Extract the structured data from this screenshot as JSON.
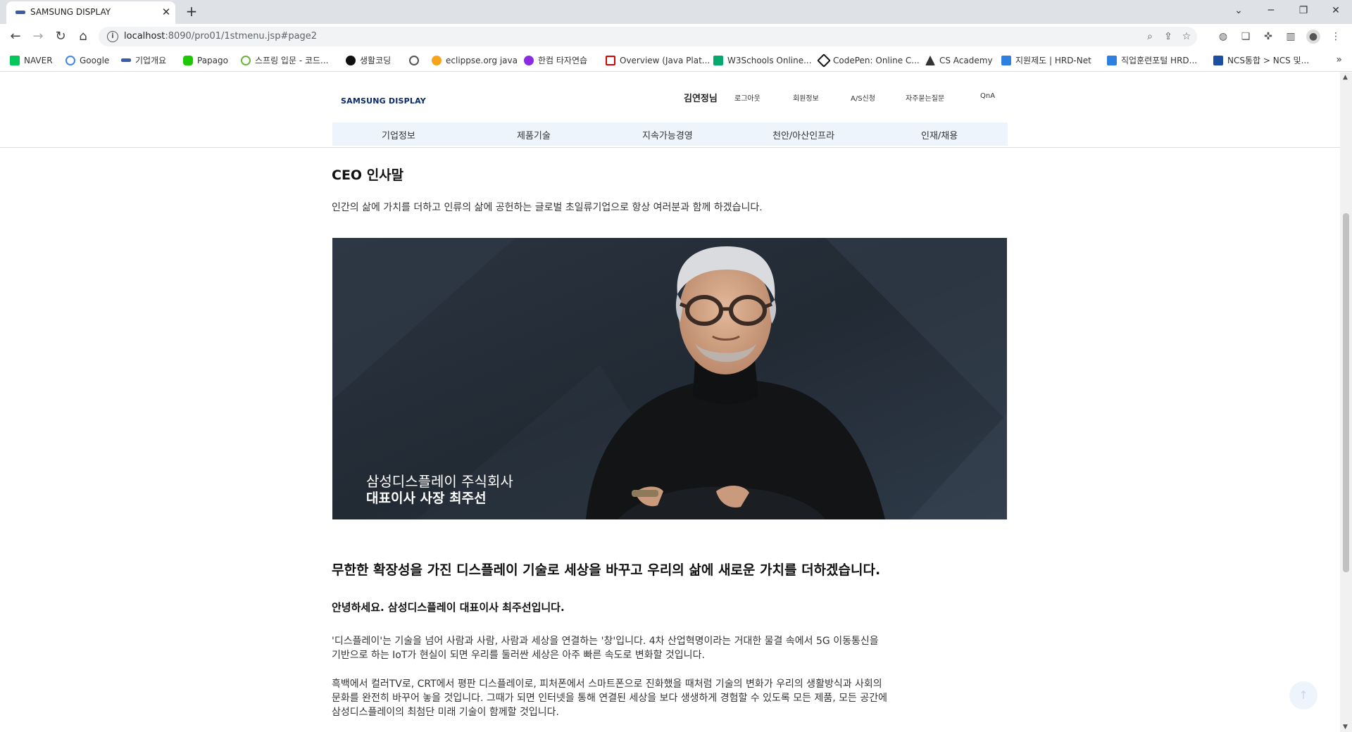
{
  "browser": {
    "tab_title": "SAMSUNG DISPLAY",
    "url_host": "localhost",
    "url_rest": ":8090/pro01/1stmenu.jsp#page2",
    "bookmarks": [
      "NAVER",
      "Google",
      "기업개요",
      "Papago",
      "스프링 입문 - 코드...",
      "생활코딩",
      "",
      "eclippse.org java",
      "한컴 타자연습",
      "Overview (Java Plat...",
      "W3Schools Online...",
      "CodePen: Online C...",
      "CS Academy",
      "지원제도 | HRD-Net",
      "직업훈련포털 HRD...",
      "NCS통합 > NCS 및..."
    ]
  },
  "header": {
    "logo": "SAMSUNG DISPLAY",
    "user": "김연정님",
    "util_links": [
      "로그아웃",
      "회원정보",
      "A/S신청",
      "자주묻는질문",
      "QnA"
    ],
    "gnb": [
      "기업정보",
      "제품기술",
      "지속가능경영",
      "천안/아산인프라",
      "인재/채용"
    ]
  },
  "content": {
    "title": "CEO 인사말",
    "lead": "인간의 삶에 가치를 더하고 인류의 삶에 공헌하는 글로벌 초일류기업으로 항상 여러분과 함께 하겠습니다.",
    "image_caption_1": "삼성디스플레이 주식회사",
    "image_caption_2": "대표이사 사장 최주선",
    "headline": "무한한 확장성을 가진 디스플레이 기술로 세상을 바꾸고 우리의 삶에 새로운 가치를 더하겠습니다.",
    "greeting": "안녕하세요. 삼성디스플레이 대표이사 최주선입니다.",
    "para1": [
      "'디스플레이'는 기술을 넘어 사람과 사람, 사람과 세상을 연결하는 '창'입니다. 4차 산업혁명이라는 거대한 물결 속에서 5G 이동통신을",
      "기반으로 하는 IoT가 현실이 되면 우리를 둘러싼 세상은 아주 빠른 속도로 변화할 것입니다."
    ],
    "para2": [
      "흑백에서 컬러TV로, CRT에서 평판 디스플레이로, 피처폰에서 스마트폰으로 진화했을 때처럼 기술의 변화가 우리의 생활방식과 사회의",
      "문화를 완전히 바꾸어 놓을 것입니다. 그때가 되면 인터넷을 통해 연결된 세상을 보다 생생하게 경험할 수 있도록 모든 제품, 모든 공간에",
      "삼성디스플레이의 최첨단 미래 기술이 함께할 것입니다."
    ],
    "top_button": "↑"
  }
}
